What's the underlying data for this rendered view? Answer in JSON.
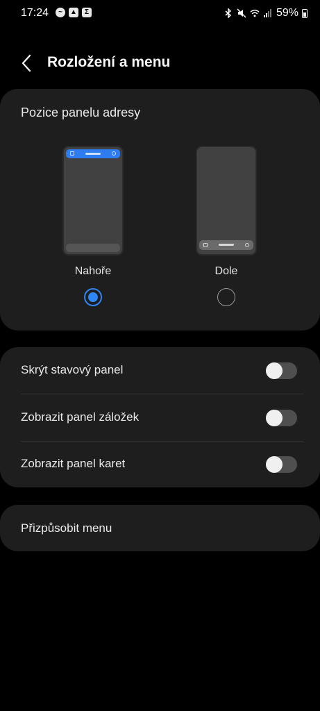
{
  "status_bar": {
    "time": "17:24",
    "left_icons": [
      "messenger-icon",
      "image-icon",
      "sigma-icon"
    ],
    "right_icons": [
      "bluetooth-icon",
      "mute-icon",
      "wifi-icon",
      "signal-icon"
    ],
    "battery": "59%"
  },
  "header": {
    "title": "Rozložení a menu"
  },
  "address_bar_position": {
    "title": "Pozice panelu adresy",
    "options": [
      {
        "label": "Nahoře",
        "selected": true
      },
      {
        "label": "Dole",
        "selected": false
      }
    ]
  },
  "toggles": [
    {
      "label": "Skrýt stavový panel",
      "on": false
    },
    {
      "label": "Zobrazit panel záložek",
      "on": false
    },
    {
      "label": "Zobrazit panel karet",
      "on": false
    }
  ],
  "menu": {
    "label": "Přizpůsobit menu"
  },
  "colors": {
    "accent": "#2f86f6",
    "card": "#1e1e1e",
    "background": "#000000"
  }
}
